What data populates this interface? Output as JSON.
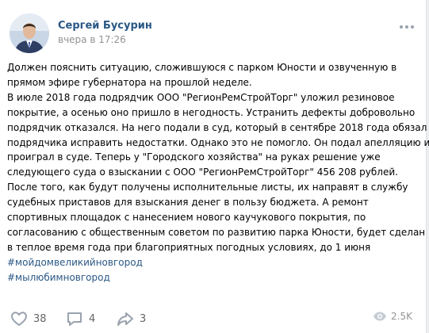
{
  "post": {
    "author": "Сергей Бусурин",
    "timestamp": "вчера в 17:26",
    "text_lines": [
      "Должен пояснить ситуацию, сложившуюся с парком Юности и озвученную в",
      "прямом эфире губернатора на прошлой неделе.",
      "В июле 2018 года подрядчик ООО \"РегионРемСтройТорг\" уложил резиновое",
      "покрытие, а осенью оно пришло в негодность. Устранить дефекты добровольно",
      "подрядчик отказался. На него подали в суд, который в сентябре 2018 года обязал",
      "подрядчика исправить недостатки. Однако это не помогло. Он подал апелляцию и",
      "проиграл в суде. Теперь у \"Городского хозяйства\" на руках решение уже",
      "следующего суда о взыскании с ООО \"РегионРемСтройТорг\" 456 208 рублей.",
      "После того, как будут получены исполнительные листы, их направят в службу",
      "судебных приставов для взыскания денег в пользу бюджета. А ремонт",
      "спортивных площадок с нанесением нового каучукового покрытия, по",
      "согласованию с общественным советом по развитию парка Юности, будет сделан",
      "в теплое время года при благоприятных погодных условиях, до 1 июня"
    ],
    "hashtags": [
      "#мойдомвеликийновгород",
      "#мылюбимновгород"
    ]
  },
  "actions": {
    "likes": "38",
    "comments": "4",
    "shares": "3",
    "views": "2.5K"
  },
  "colors": {
    "link": "#2a5885",
    "icon": "#99a2ad",
    "muted": "#939393"
  },
  "icons": {
    "more": "more-horizontal-icon",
    "like": "heart-icon",
    "comment": "comment-icon",
    "share": "share-icon",
    "views": "eye-icon"
  }
}
